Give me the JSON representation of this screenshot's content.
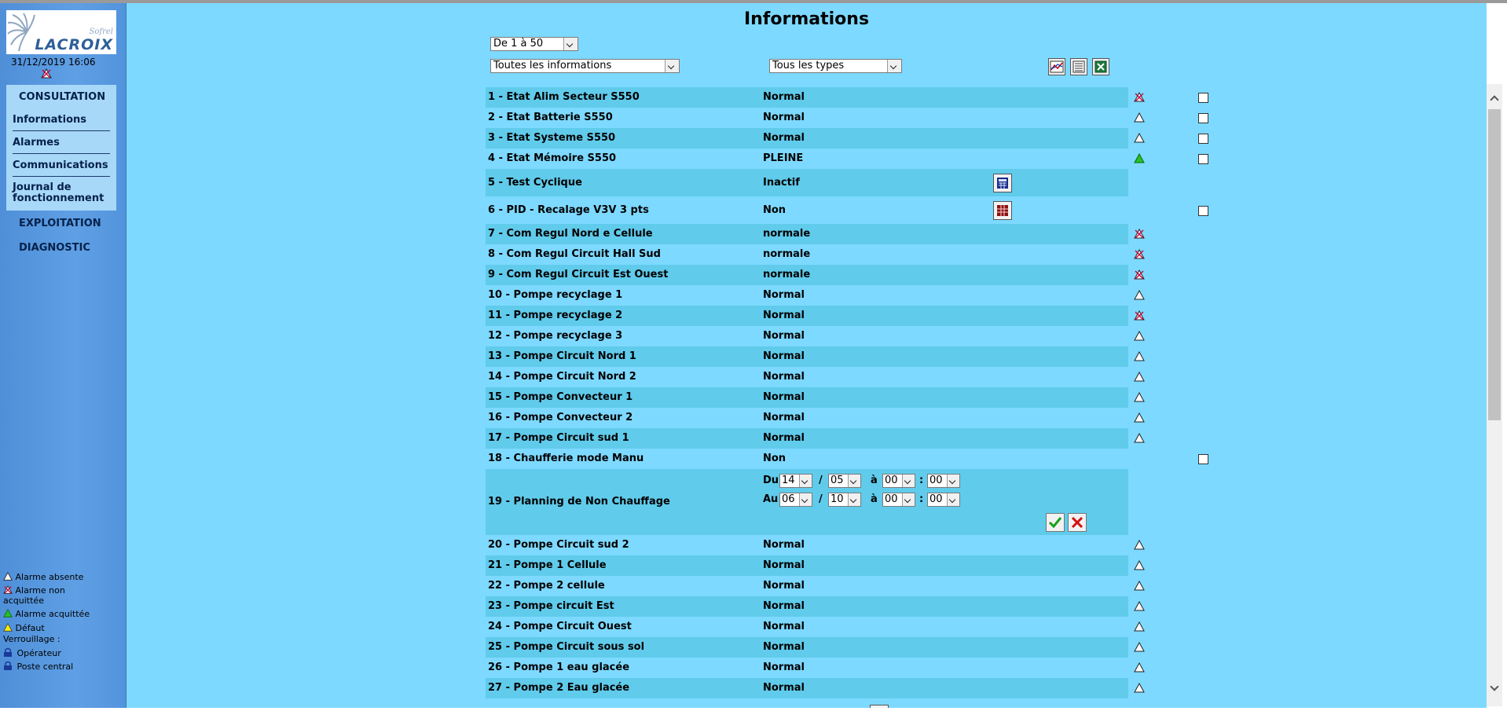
{
  "sidebar": {
    "logo_small": "Sofrel",
    "logo_brand": "LACROIX",
    "datetime": "31/12/2019 16:06",
    "section_consultation": "CONSULTATION",
    "items": [
      {
        "label": "Informations"
      },
      {
        "label": "Alarmes"
      },
      {
        "label": "Communications"
      },
      {
        "label": "Journal de fonctionnement"
      }
    ],
    "section_exploitation": "EXPLOITATION",
    "section_diagnostic": "DIAGNOSTIC",
    "legend": {
      "absent": "Alarme absente",
      "non_acq": "Alarme non acquittée",
      "acq": "Alarme acquittée",
      "defaut": "Défaut",
      "verrouillage": "Verrouillage :",
      "operateur": "Opérateur",
      "poste": "Poste central"
    }
  },
  "main": {
    "title": "Informations",
    "range_select": "De 1 à 50",
    "info_select": "Toutes les informations",
    "type_select": "Tous les types"
  },
  "rows": [
    {
      "label": "1 - Etat Alim Secteur S550",
      "value": "Normal",
      "alarm": "non_acq",
      "checkbox": true
    },
    {
      "label": "2 - Etat Batterie S550",
      "value": "Normal",
      "alarm": "absent",
      "checkbox": true
    },
    {
      "label": "3 - Etat Systeme S550",
      "value": "Normal",
      "alarm": "absent",
      "checkbox": true
    },
    {
      "label": "4 - Etat Mémoire S550",
      "value": "PLEINE",
      "alarm": "acq",
      "checkbox": true
    },
    {
      "label": "5 - Test Cyclique",
      "value": "Inactif",
      "alarm": "",
      "checkbox": false,
      "command": "calc"
    },
    {
      "label": "6 - PID - Recalage V3V 3 pts",
      "value": "Non",
      "alarm": "",
      "checkbox": true,
      "command": "grid"
    },
    {
      "label": "7 - Com Regul Nord e Cellule",
      "value": "normale",
      "alarm": "non_acq",
      "checkbox": false
    },
    {
      "label": "8 - Com Regul Circuit Hall Sud",
      "value": "normale",
      "alarm": "non_acq",
      "checkbox": false
    },
    {
      "label": "9 - Com Regul Circuit Est Ouest",
      "value": "normale",
      "alarm": "non_acq",
      "checkbox": false
    },
    {
      "label": "10 - Pompe recyclage 1",
      "value": "Normal",
      "alarm": "absent",
      "checkbox": false
    },
    {
      "label": "11 - Pompe recyclage 2",
      "value": "Normal",
      "alarm": "non_acq",
      "checkbox": false
    },
    {
      "label": "12 - Pompe recyclage 3",
      "value": "Normal",
      "alarm": "absent",
      "checkbox": false
    },
    {
      "label": "13 - Pompe Circuit Nord 1",
      "value": "Normal",
      "alarm": "absent",
      "checkbox": false
    },
    {
      "label": "14 - Pompe Circuit Nord 2",
      "value": "Normal",
      "alarm": "absent",
      "checkbox": false
    },
    {
      "label": "15 - Pompe Convecteur 1",
      "value": "Normal",
      "alarm": "absent",
      "checkbox": false
    },
    {
      "label": "16 - Pompe Convecteur 2",
      "value": "Normal",
      "alarm": "absent",
      "checkbox": false
    },
    {
      "label": "17 - Pompe Circuit sud 1",
      "value": "Normal",
      "alarm": "absent",
      "checkbox": false
    },
    {
      "label": "18 - Chaufferie mode Manu",
      "value": "Non",
      "alarm": "",
      "checkbox": true
    },
    {
      "label": "19 - Planning de Non Chauffage",
      "value": "",
      "alarm": "",
      "checkbox": false,
      "planning": true
    },
    {
      "label": "20 - Pompe Circuit sud 2",
      "value": "Normal",
      "alarm": "absent",
      "checkbox": false
    },
    {
      "label": "21 - Pompe 1 Cellule",
      "value": "Normal",
      "alarm": "absent",
      "checkbox": false
    },
    {
      "label": "22 - Pompe 2 cellule",
      "value": "Normal",
      "alarm": "absent",
      "checkbox": false
    },
    {
      "label": "23 - Pompe circuit Est",
      "value": "Normal",
      "alarm": "absent",
      "checkbox": false
    },
    {
      "label": "24 - Pompe Circuit Ouest",
      "value": "Normal",
      "alarm": "absent",
      "checkbox": false
    },
    {
      "label": "25 - Pompe Circuit sous sol",
      "value": "Normal",
      "alarm": "absent",
      "checkbox": false
    },
    {
      "label": "26 - Pompe 1 eau glacée",
      "value": "Normal",
      "alarm": "absent",
      "checkbox": false
    },
    {
      "label": "27 - Pompe 2 Eau glacée",
      "value": "Normal",
      "alarm": "absent",
      "checkbox": false
    }
  ],
  "planning": {
    "du": "Du",
    "au": "Au",
    "slash": "/",
    "a": "à",
    "colon": ":",
    "start": {
      "day": "14",
      "month": "05",
      "hour": "00",
      "minute": "00"
    },
    "end": {
      "day": "06",
      "month": "10",
      "hour": "00",
      "minute": "00"
    }
  }
}
